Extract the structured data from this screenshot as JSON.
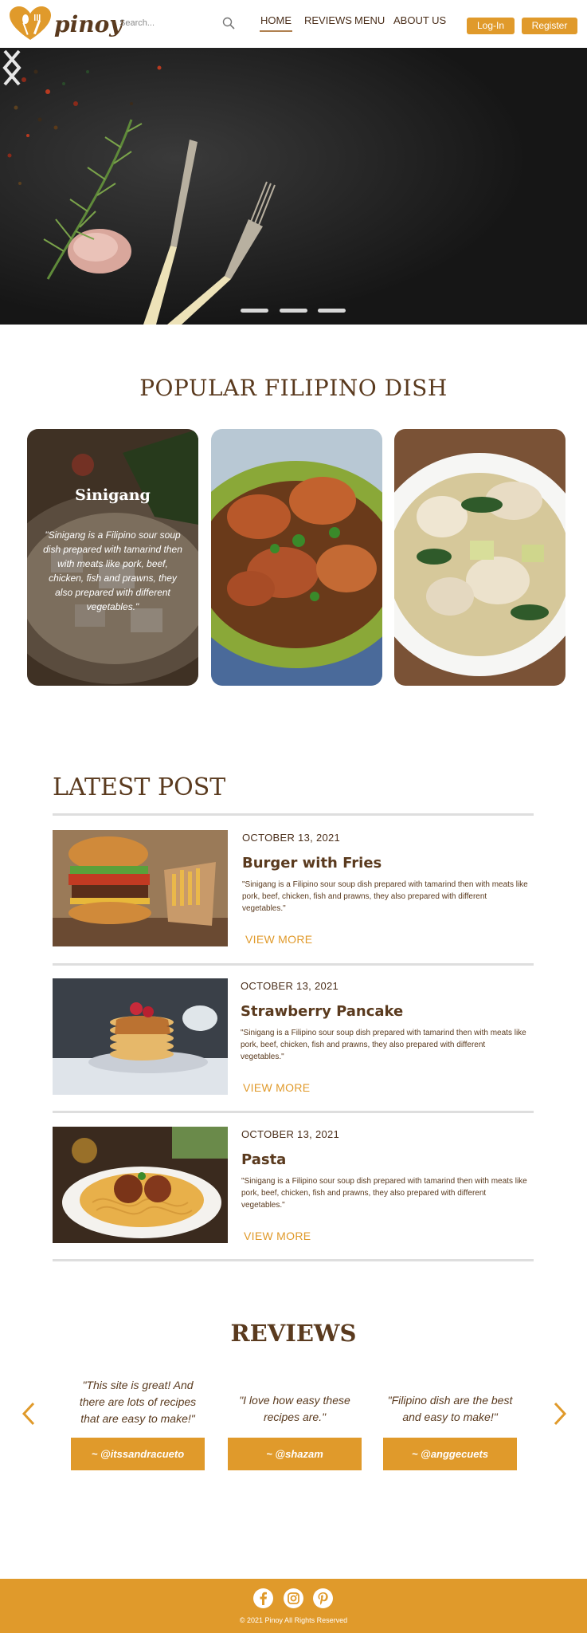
{
  "brand": {
    "name": "pinoy",
    "logo_icon": "heart-spoon-fork-logo",
    "accent": "#e09a2b",
    "text_color": "#5a3a1e"
  },
  "header": {
    "search_placeholder": "Search...",
    "nav": {
      "home": "HOME",
      "reviews": "REVIEWS",
      "menu": "MENU",
      "about": "ABOUT US"
    },
    "login": "Log-In",
    "register": "Register"
  },
  "hero": {
    "slides": 3,
    "active_slide": 1
  },
  "popular": {
    "title": "POPULAR FILIPINO DISH",
    "dishes": [
      {
        "name": "Sinigang",
        "description": "\"Sinigang is a Filipino sour soup dish prepared with tamarind then with meats like pork, beef, chicken, fish and prawns, they also prepared with different vegetables.\""
      }
    ]
  },
  "latest": {
    "title": "LATEST POST",
    "posts": [
      {
        "date": "OCTOBER 13, 2021",
        "title": "Burger with Fries",
        "description": "\"Sinigang is a Filipino sour soup dish prepared with tamarind then with meats like pork, beef, chicken, fish and prawns, they also prepared with different vegetables.\"",
        "more": "VIEW MORE"
      },
      {
        "date": "OCTOBER 13, 2021",
        "title": "Strawberry Pancake",
        "description": "\"Sinigang is a Filipino sour soup dish prepared with tamarind then with meats like pork, beef, chicken, fish and prawns, they also prepared with different vegetables.\"",
        "more": "VIEW MORE"
      },
      {
        "date": "OCTOBER 13, 2021",
        "title": "Pasta",
        "description": "\"Sinigang is a Filipino sour soup dish prepared with tamarind then with meats like pork, beef, chicken, fish and prawns, they also prepared with different vegetables.\"",
        "more": "VIEW MORE"
      }
    ]
  },
  "reviews": {
    "title": "REVIEWS",
    "items": [
      {
        "quote": "\"This site is great! And there are lots of recipes that are easy to make!\"",
        "handle": "~ @itssandracueto"
      },
      {
        "quote": "\"I love how easy these recipes are.\"",
        "handle": "~ @shazam"
      },
      {
        "quote": "\"Filipino dish are the best and easy to make!\"",
        "handle": "~ @anggecuets"
      }
    ]
  },
  "footer": {
    "social_icons": [
      "facebook-icon",
      "instagram-icon",
      "pinterest-icon"
    ],
    "copyright": "© 2021 Pinoy All Rights Reserved"
  }
}
